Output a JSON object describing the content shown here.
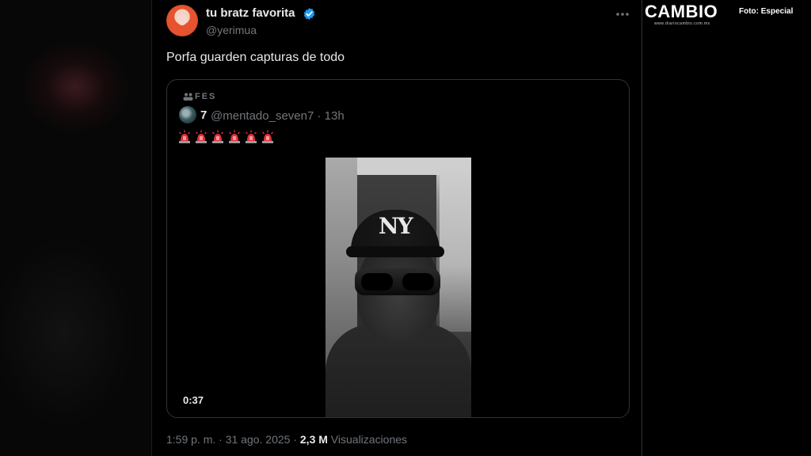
{
  "tweet": {
    "display_name": "tu bratz favorita",
    "handle": "@yerimua",
    "text": "Porfa guarden capturas de todo",
    "timestamp": "1:59 p. m. · 31 ago. 2025 · ",
    "views_count": "2,3 M",
    "views_label": " Visualizaciones"
  },
  "quoted": {
    "community": "FES",
    "name": "7",
    "handle": "@mentado_seven7 · 13h",
    "emoji": [
      "🚨",
      "🚨",
      "🚨",
      "🚨",
      "🚨",
      "🚨"
    ],
    "video_logo": "NY",
    "video_duration": "0:37"
  },
  "overlay": {
    "brand": "CAMBIO",
    "brand_sub": "www.diariocambio.com.mx",
    "photo_credit": "Foto: Especial"
  },
  "icons": {
    "verified": "verified-badge-icon",
    "more": "more-horizontal-icon",
    "community": "community-people-icon"
  },
  "colors": {
    "verified_blue": "#1d9bf0",
    "muted_text": "#71767b",
    "siren_red": "#e0303a"
  }
}
